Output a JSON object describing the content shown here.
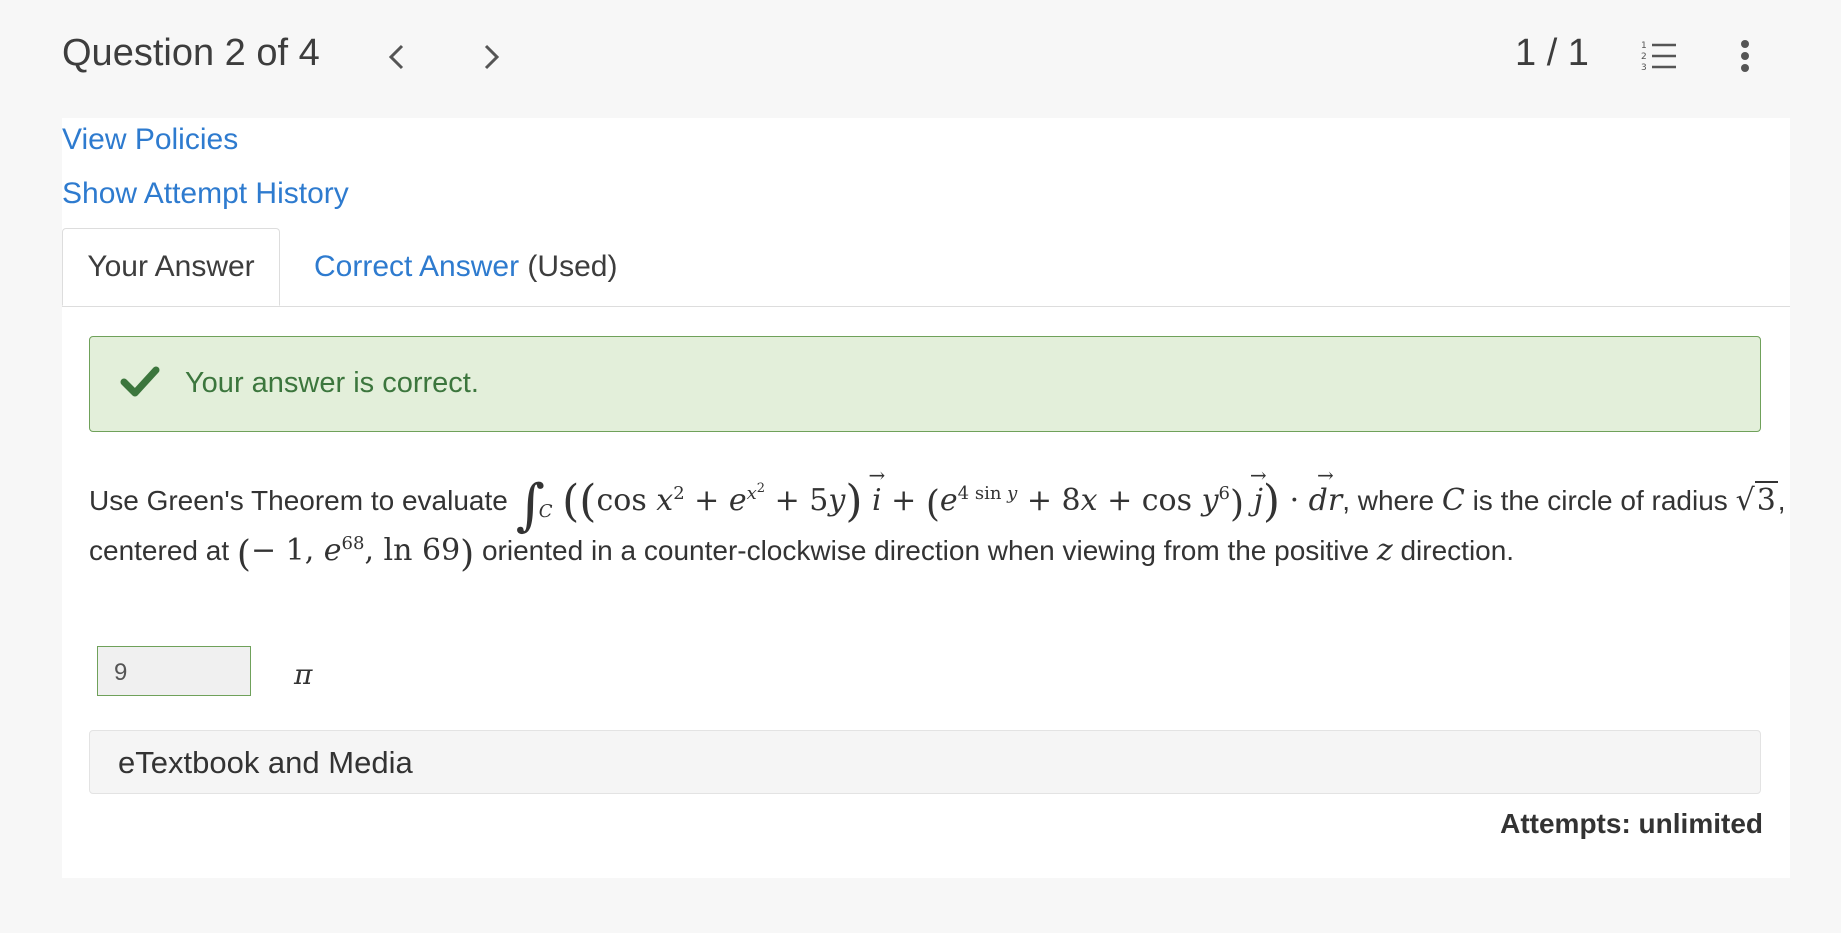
{
  "header": {
    "question_label": "Question 2 of 4",
    "page_count": "1 / 1",
    "icons": {
      "prev": "chevron-left-icon",
      "next": "chevron-right-icon",
      "list": "numbered-list-icon",
      "more": "more-vertical-icon"
    }
  },
  "links": {
    "view_policies": "View Policies",
    "show_attempt_history": "Show Attempt History"
  },
  "tabs": {
    "your_answer": "Your Answer",
    "correct_answer": "Correct Answer",
    "correct_answer_suffix": " (Used)"
  },
  "feedback": {
    "message": "Your answer is correct.",
    "icon": "checkmark-icon",
    "color": "#3c763d"
  },
  "question": {
    "prefix": "Use Green's Theorem to evaluate",
    "where_text": ", where",
    "curve_var": "C",
    "is_circle_text": "is the circle of radius",
    "radius": "3",
    "centered_text": "centered at",
    "oriented_text": "oriented in a counter-clockwise direction when viewing from the positive",
    "axis_var": "z",
    "direction_text": "direction."
  },
  "answer": {
    "value": "9",
    "unit": "π"
  },
  "media": {
    "label": "eTextbook and Media"
  },
  "attempts": {
    "label": "Attempts: unlimited"
  },
  "colors": {
    "link": "#2e7bcf",
    "success_bg": "#e3efda",
    "success_border": "#6fa15a"
  }
}
